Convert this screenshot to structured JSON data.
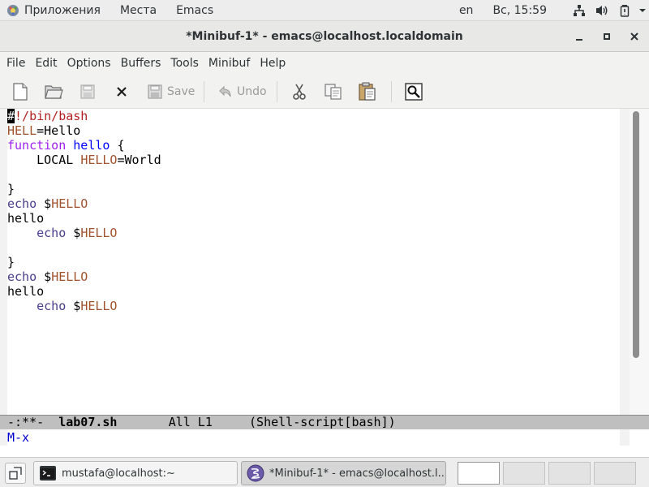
{
  "topbar": {
    "apps_label": "Приложения",
    "places_label": "Места",
    "app_label": "Emacs",
    "lang": "en",
    "clock": "Вс, 15:59",
    "icons": [
      "network-icon",
      "volume-icon",
      "battery-icon"
    ]
  },
  "window": {
    "title": "*Minibuf-1* - emacs@localhost.localdomain",
    "minimize": "−",
    "maximize": "▪",
    "close": "✕"
  },
  "menu": [
    "File",
    "Edit",
    "Options",
    "Buffers",
    "Tools",
    "Minibuf",
    "Help"
  ],
  "toolbar": {
    "save_label": "Save",
    "undo_label": "Undo",
    "icons": [
      "new-file-icon",
      "open-folder-icon",
      "save-disk-icon",
      "close-icon",
      "save-icon",
      "undo-icon",
      "cut-icon",
      "copy-icon",
      "paste-icon",
      "search-icon"
    ]
  },
  "editor": {
    "lines": [
      [
        {
          "t": "#",
          "c": "cursor"
        },
        {
          "t": "!/bin/bash",
          "c": "comment"
        }
      ],
      [
        {
          "t": "HELL",
          "c": "var"
        },
        {
          "t": "=Hello",
          "c": ""
        }
      ],
      [
        {
          "t": "function",
          "c": "kw"
        },
        {
          "t": " ",
          "c": ""
        },
        {
          "t": "hello",
          "c": "fn"
        },
        {
          "t": " {",
          "c": ""
        }
      ],
      [
        {
          "t": "    LOCAL ",
          "c": ""
        },
        {
          "t": "HELLO",
          "c": "var"
        },
        {
          "t": "=World",
          "c": ""
        }
      ],
      [],
      [
        {
          "t": "}",
          "c": ""
        }
      ],
      [
        {
          "t": "echo",
          "c": "builtin"
        },
        {
          "t": " $",
          "c": ""
        },
        {
          "t": "HELLO",
          "c": "var"
        }
      ],
      [
        {
          "t": "hello",
          "c": ""
        }
      ],
      [
        {
          "t": "    ",
          "c": ""
        },
        {
          "t": "echo",
          "c": "builtin"
        },
        {
          "t": " $",
          "c": ""
        },
        {
          "t": "HELLO",
          "c": "var"
        }
      ],
      [],
      [
        {
          "t": "}",
          "c": ""
        }
      ],
      [
        {
          "t": "echo",
          "c": "builtin"
        },
        {
          "t": " $",
          "c": ""
        },
        {
          "t": "HELLO",
          "c": "var"
        }
      ],
      [
        {
          "t": "hello",
          "c": ""
        }
      ],
      [
        {
          "t": "    ",
          "c": ""
        },
        {
          "t": "echo",
          "c": "builtin"
        },
        {
          "t": " $",
          "c": ""
        },
        {
          "t": "HELLO",
          "c": "var"
        }
      ]
    ],
    "colors": {
      "comment": "#b22222",
      "variable": "#a0522d",
      "keyword": "#a020f0",
      "function": "#0000ff",
      "builtin": "#483d8b"
    }
  },
  "modeline": {
    "status": "-:**-",
    "buffer_name": "lab07.sh",
    "position": "All L1",
    "mode": "(Shell-script[bash])"
  },
  "minibuffer": {
    "prompt": "M-x"
  },
  "taskbar": {
    "tasks": [
      {
        "label": "mustafa@localhost:~",
        "icon": "terminal-icon",
        "active": false
      },
      {
        "label": "*Minibuf-1* - emacs@localhost.l...",
        "icon": "emacs-icon",
        "active": true
      }
    ],
    "workspaces": 4,
    "current_workspace": 1
  }
}
